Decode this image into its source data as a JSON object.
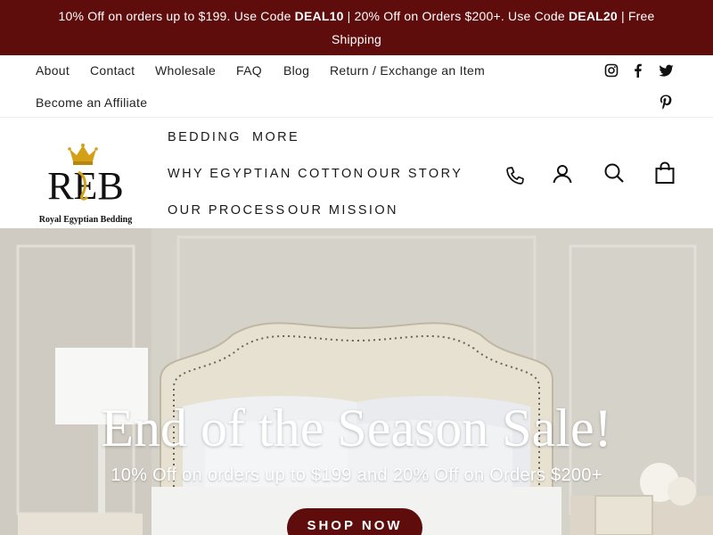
{
  "announcement": {
    "part1": "10% Off on orders up to $199. Use Code ",
    "code1": "DEAL10",
    "part2": " | 20% Off on Orders $200+. Use Code ",
    "code2": "DEAL20",
    "part3": " | Free Shipping"
  },
  "utility_links": {
    "about": "About",
    "contact": "Contact",
    "wholesale": "Wholesale",
    "faq": "FAQ",
    "blog": "Blog",
    "return": "Return / Exchange an Item",
    "affiliate": "Become an Affiliate"
  },
  "social": [
    "instagram-icon",
    "facebook-icon",
    "twitter-icon",
    "pinterest-icon"
  ],
  "logo": {
    "monogram": "REB",
    "text": "Royal Egyptian Bedding"
  },
  "nav": {
    "bedding": "BEDDING",
    "more": "MORE",
    "why": "WHY EGYPTIAN COTTON",
    "story": "OUR STORY",
    "process": "OUR PROCESS",
    "mission": "OUR MISSION"
  },
  "header_icons": [
    "phone-icon",
    "account-icon",
    "search-icon",
    "cart-icon"
  ],
  "hero": {
    "title": "End of the Season Sale!",
    "subtitle": "10% Off on orders up to $199 and 20% Off on Orders $200+",
    "button": "SHOP NOW"
  },
  "colors": {
    "brand": "#5e0c0c",
    "gold": "#d4a017"
  }
}
